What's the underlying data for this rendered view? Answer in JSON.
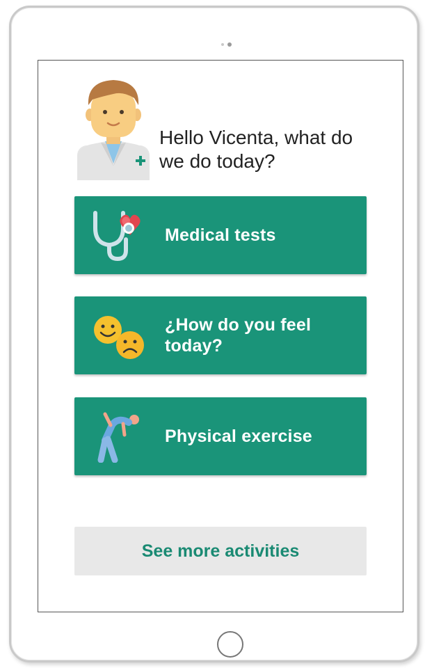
{
  "greeting": {
    "text": "Hello Vicenta, what do we do today?",
    "avatar_icon": "doctor-avatar-icon"
  },
  "activities": [
    {
      "label": "Medical tests",
      "icon": "stethoscope-heart-icon"
    },
    {
      "label": "¿How do you feel today?",
      "icon": "happy-sad-faces-icon"
    },
    {
      "label": "Physical exercise",
      "icon": "stretching-person-icon"
    }
  ],
  "more_button": {
    "label": "See more activities"
  },
  "colors": {
    "primary": "#1a9479",
    "secondary_bg": "#e8e8e8",
    "secondary_text": "#1a8a73"
  }
}
